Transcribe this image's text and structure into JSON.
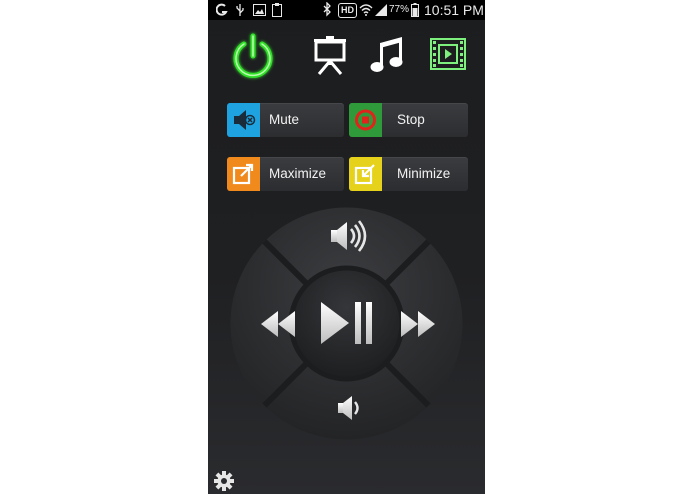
{
  "status_bar": {
    "battery_percent": "77%",
    "time": "10:51 PM",
    "hd_badge": "HD",
    "icons": [
      "g-icon",
      "usb-icon",
      "image-icon",
      "clipboard-icon",
      "bluetooth-icon",
      "hd-badge",
      "wifi-icon",
      "signal-icon",
      "battery-icon"
    ]
  },
  "top_icons": [
    "power-icon",
    "presentation-icon",
    "music-icon",
    "video-icon"
  ],
  "colors": {
    "power_green": "#33e02a",
    "mute_blue": "#1fa3e0",
    "stop_green": "#2f9a3a",
    "stop_red": "#e0241c",
    "maximize_orange": "#f08a1d",
    "minimize_yellow": "#e6d21a",
    "video_green": "#7ef07e"
  },
  "buttons": {
    "mute": "Mute",
    "stop": "Stop",
    "maximize": "Maximize",
    "minimize": "Minimize"
  },
  "dpad": {
    "center": "play-pause-icon",
    "up": "volume-up-icon",
    "down": "volume-down-icon",
    "left": "rewind-icon",
    "right": "fast-forward-icon"
  },
  "settings": "gear-icon"
}
